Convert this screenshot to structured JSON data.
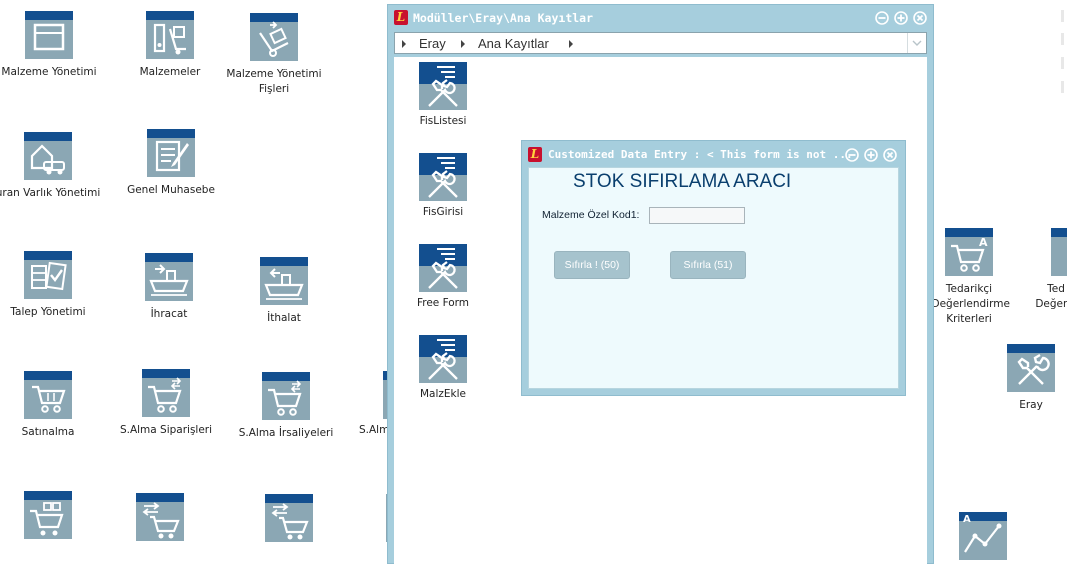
{
  "desktop": {
    "icons": [
      {
        "label": "Malzeme Yönetimi",
        "icon": "window-panel-icon"
      },
      {
        "label": "Malzemeler",
        "icon": "binder-cart-icon"
      },
      {
        "label": "Malzeme Yönetimi Fişleri",
        "icon": "hand-truck-icon"
      },
      {
        "label": "uran Varlık Yönetimi",
        "icon": "house-car-icon"
      },
      {
        "label": "Genel Muhasebe",
        "icon": "ledger-pen-icon"
      },
      {
        "label": "Talep Yönetimi",
        "icon": "checklist-icon"
      },
      {
        "label": "İhracat",
        "icon": "ship-export-icon"
      },
      {
        "label": "İthalat",
        "icon": "ship-import-icon"
      },
      {
        "label": "Satınalma",
        "icon": "shopping-cart-icon"
      },
      {
        "label": "S.Alma Siparişleri",
        "icon": "cart-exchange-icon"
      },
      {
        "label": "S.Alma İrsaliyeleri",
        "icon": "cart-exchange-icon"
      },
      {
        "label": "S.Alm",
        "icon": "cart-icon"
      },
      {
        "label": "Tedarikçi Değerlendirme Kriterleri",
        "icon": "cart-letter-icon"
      },
      {
        "label": "Ted Değerle",
        "icon": "cart-letter-icon"
      },
      {
        "label": "Eray",
        "icon": "wrench-screwdriver-icon"
      },
      {
        "label": "",
        "icon": "cart-boxes-icon"
      },
      {
        "label": "",
        "icon": "cart-swap-icon"
      },
      {
        "label": "",
        "icon": "cart-swap-icon"
      },
      {
        "label": "",
        "icon": "trend-chart-icon"
      }
    ],
    "tile_colors": {
      "body": "#8ba7b4",
      "header": "#134f8f"
    }
  },
  "modules_window": {
    "title": "Modüller\\Eray\\Ana Kayıtlar",
    "breadcrumb": [
      "Eray",
      "Ana Kayıtlar"
    ],
    "items": [
      {
        "label": "FisListesi",
        "icon": "wrench-screwdriver-icon"
      },
      {
        "label": "FisGirisi",
        "icon": "wrench-screwdriver-icon"
      },
      {
        "label": "Free Form",
        "icon": "wrench-screwdriver-icon"
      },
      {
        "label": "MalzEkle",
        "icon": "wrench-screwdriver-icon"
      }
    ]
  },
  "form_window": {
    "title": "Customized Data Entry : < This form is not ...",
    "heading": "STOK SIFIRLAMA ARACI",
    "field_label": "Malzeme Özel Kod1:",
    "field_value": "",
    "button_1": "Sıfırla ! (50)",
    "button_2": "Sıfırla (51)"
  },
  "colors": {
    "frame": "#a6cedd",
    "form_bg": "#eefafd",
    "heading": "#0a3f6e",
    "logo_red": "#c8102e"
  }
}
